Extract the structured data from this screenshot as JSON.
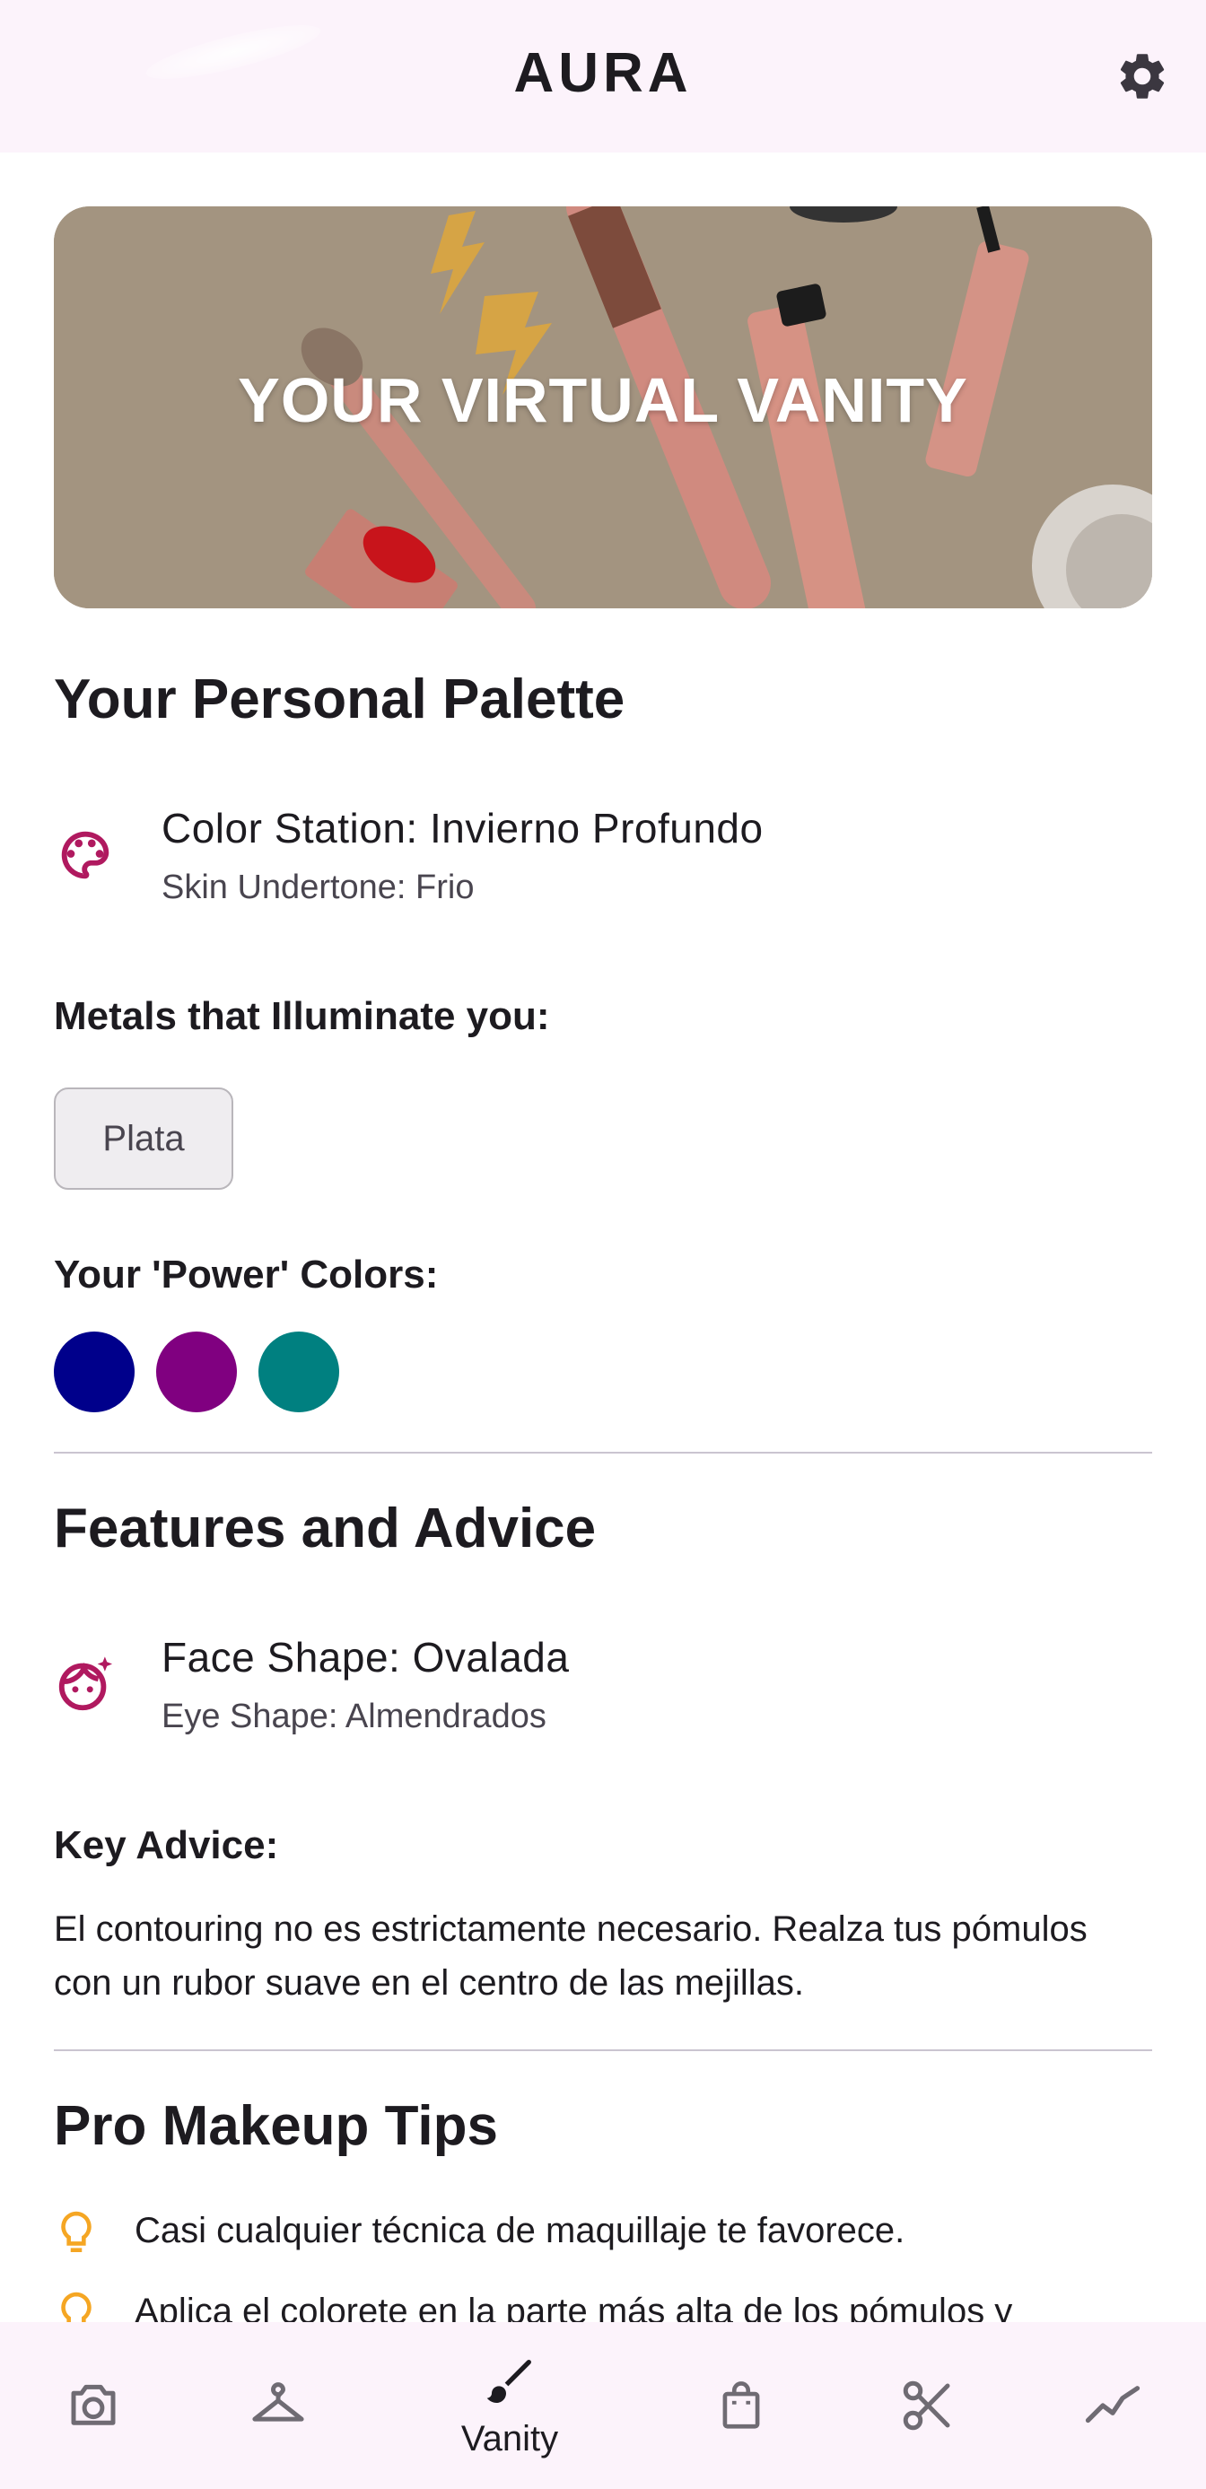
{
  "app_bar": {
    "title": "AURA",
    "settings_icon": "gear-icon"
  },
  "hero": {
    "title": "YOUR VIRTUAL VANITY"
  },
  "palette": {
    "section_title": "Your Personal Palette",
    "color_station": "Color Station: Invierno Profundo",
    "undertone": "Skin Undertone: Frio",
    "metals_label": "Metals that Illuminate you:",
    "metal_chip": "Plata",
    "power_colors_label": "Your 'Power' Colors:",
    "power_colors": [
      "#00008b",
      "#800080",
      "#008080"
    ]
  },
  "features": {
    "section_title": "Features and Advice",
    "face_shape": "Face Shape: Ovalada",
    "eye_shape": "Eye Shape: Almendrados",
    "key_advice_label": "Key Advice:",
    "key_advice_text": "El contouring no es estrictamente necesario. Realza tus pómulos con un rubor suave en el centro de las mejillas."
  },
  "tips": {
    "section_title": "Pro Makeup Tips",
    "items": [
      "Casi cualquier técnica de maquillaje te favorece.",
      "Aplica el colorete en la parte más alta de los pómulos y"
    ]
  },
  "nav": {
    "active_label": "Vanity",
    "items": [
      "camera-icon",
      "hanger-icon",
      "brush-icon",
      "shopping-bag-icon",
      "scissors-icon",
      "trending-icon"
    ]
  },
  "colors": {
    "accent": "#b0195f",
    "tip_icon": "#f5a623",
    "app_bar_bg": "#fcf3fb"
  }
}
